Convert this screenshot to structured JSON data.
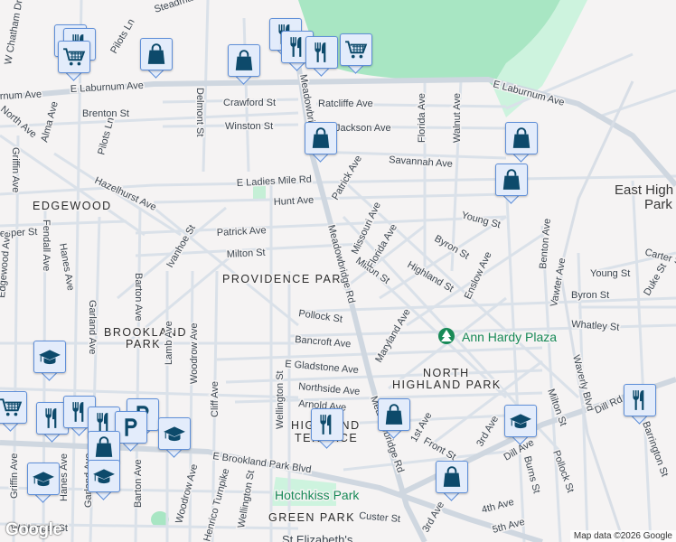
{
  "map": {
    "areas": {
      "edgewood": "EDGEWOOD",
      "providence_park": "PROVIDENCE PARK",
      "brookland_park_1": "BROOKLAND",
      "brookland_park_2": "PARK",
      "north_highland_1": "NORTH",
      "north_highland_2": "HIGHLAND PARK",
      "highland_terrace_1": "HIGHLAND",
      "highland_terrace_2": "TERRACE",
      "green_park": "GREEN PARK",
      "east_highland_1": "East High",
      "east_highland_2": "Park"
    },
    "pois": {
      "hotchkiss": "Hotchkiss Park",
      "ann_hardy": "Ann Hardy Plaza",
      "st_elizabeth": "St Elizabeth's"
    },
    "streets": [
      "rnum Ave",
      "E Laburnum Ave",
      "E Laburnum Ave",
      "Crawford St",
      "Ratcliffe Ave",
      "Jackson Ave",
      "Winston St",
      "Brenton St",
      "Savannah Ave",
      "E Ladies Mile Rd",
      "Hunt Ave",
      "Patrick Ave",
      "Patrick Ave",
      "Milton St",
      "Milton St",
      "Missouri Ave",
      "Florida Ave",
      "Byron St",
      "Young St",
      "Highland St",
      "Enslow Ave",
      "Meadowbridge Rd",
      "Meadowbridge Rd",
      "Meadowbridge Rd",
      "Delmont St",
      "Pilots Ln",
      "Pilots Ln",
      "Alma Ave",
      "North Ave",
      "W Chatham Dr",
      "Steadman",
      "Hazelhurst Ave",
      "Griffin Ave",
      "Fendall Ave",
      "Hanes Ave",
      "Garland Ave",
      "Barton Ave",
      "Ivanhoe St",
      "epper St",
      "Edgewood Ave",
      "Pollock St",
      "Bancroft Ave",
      "E Gladstone Ave",
      "Northside Ave",
      "Arnold Ave",
      "Maryland Ave",
      "Walnut Ave",
      "Florida Ave",
      "Benton Ave",
      "Carter St",
      "Young St",
      "Vawter Ave",
      "Byron St",
      "Whatley St",
      "Duke St",
      "Waverly Blvd",
      "Milton St",
      "Dill Rd",
      "Dill Ave",
      "Pollock St",
      "Barrington St",
      "Lamb Ave",
      "Woodrow Ave",
      "Cliff Ave",
      "Wellington St",
      "E Brookland Park Blvd",
      "Woodrow Ave",
      "Henrico Turnpike",
      "Wellington St",
      "Barton Ave",
      "Griffin Ave",
      "Hanes Ave",
      "Garland Ave",
      "W Hooper St",
      "1st Ave",
      "Front St",
      "3rd Ave",
      "3rd Ave",
      "4th Ave",
      "5th Ave",
      "Burns St",
      "Custer St"
    ],
    "markers": [
      {
        "type": "restaurant"
      },
      {
        "type": "restaurant"
      },
      {
        "type": "grocery"
      },
      {
        "type": "shopping"
      },
      {
        "type": "shopping"
      },
      {
        "type": "restaurant"
      },
      {
        "type": "restaurant"
      },
      {
        "type": "restaurant"
      },
      {
        "type": "grocery"
      },
      {
        "type": "shopping"
      },
      {
        "type": "shopping"
      },
      {
        "type": "shopping"
      },
      {
        "type": "restaurant"
      },
      {
        "type": "education"
      },
      {
        "type": "shopping"
      },
      {
        "type": "shopping"
      },
      {
        "type": "restaurant"
      },
      {
        "type": "education"
      },
      {
        "type": "grocery"
      },
      {
        "type": "restaurant"
      },
      {
        "type": "restaurant"
      },
      {
        "type": "restaurant"
      },
      {
        "type": "parking"
      },
      {
        "type": "parking"
      },
      {
        "type": "shopping"
      },
      {
        "type": "education"
      },
      {
        "type": "education"
      },
      {
        "type": "education"
      }
    ],
    "colors": {
      "background": "#f5f3f3",
      "road": "#d4dde6",
      "major_road": "#cdd5de",
      "park": "#a8e6c3",
      "park_light": "#cdf3de",
      "icon": "#0d4a6b"
    }
  },
  "footer": {
    "logo": "Google",
    "attribution": "Map data ©2026 Google"
  }
}
